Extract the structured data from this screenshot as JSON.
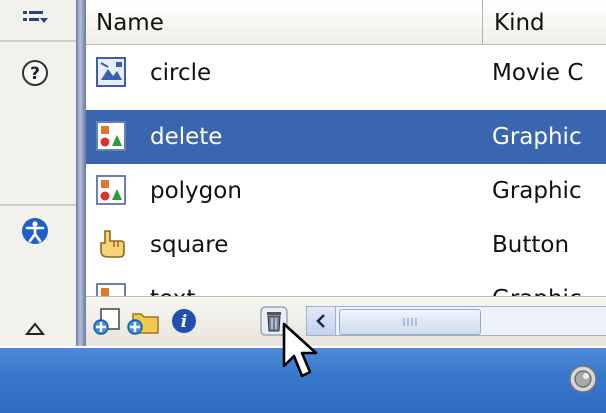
{
  "library": {
    "columns": {
      "name": "Name",
      "kind": "Kind"
    },
    "rows": [
      {
        "name": "circle",
        "kind": "Movie C",
        "icon": "movie-clip-symbol-icon",
        "selected": false
      },
      {
        "name": "delete",
        "kind": "Graphic",
        "icon": "graphic-symbol-icon",
        "selected": true
      },
      {
        "name": "polygon",
        "kind": "Graphic",
        "icon": "graphic-symbol-icon",
        "selected": false
      },
      {
        "name": "square",
        "kind": "Button",
        "icon": "button-symbol-icon",
        "selected": false
      },
      {
        "name": "text",
        "kind": "Graphic",
        "icon": "graphic-symbol-icon",
        "selected": false
      }
    ]
  },
  "left_panel": {
    "icons": [
      "list-options-icon",
      "help-icon",
      "accessibility-icon",
      "collapse-triangle-icon"
    ]
  },
  "toolbar": {
    "icons": [
      "new-symbol-icon",
      "new-folder-icon",
      "properties-icon",
      "delete-icon",
      "scroll-left-icon"
    ]
  },
  "colors": {
    "selection": "#3a66b0",
    "statusbar": "#3a78cc",
    "accent_blue": "#1f5fc8"
  }
}
